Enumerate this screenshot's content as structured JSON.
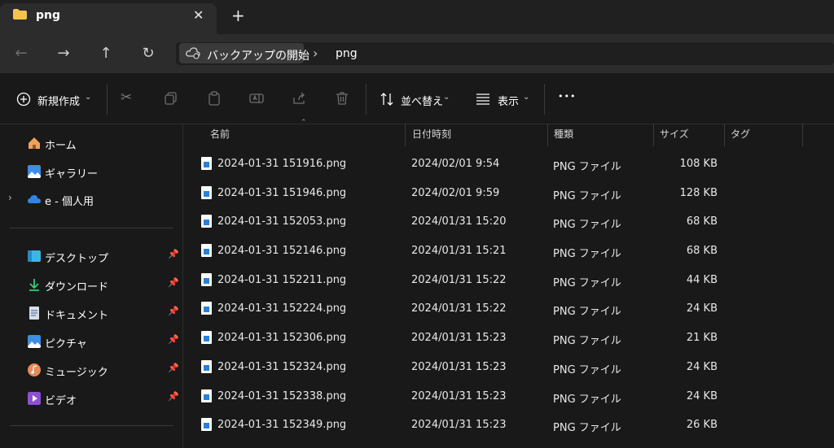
{
  "window": {
    "tab_title": "png",
    "close_glyph": "✕",
    "newtab_glyph": "+"
  },
  "nav": {
    "back_glyph": "←",
    "forward_glyph": "→",
    "up_glyph": "↑",
    "refresh_glyph": "↻",
    "breadcrumb": [
      "バックアップの開始",
      "png"
    ],
    "separator": "›"
  },
  "toolbar": {
    "new_label": "新規作成",
    "sort_label": "並べ替え",
    "view_label": "表示",
    "more_glyph": "•••"
  },
  "sidebar": {
    "top_items": [
      {
        "label": "ホーム",
        "icon": "home-icon"
      },
      {
        "label": "ギャラリー",
        "icon": "gallery-icon"
      },
      {
        "label": "e - 個人用",
        "icon": "cloud-icon"
      }
    ],
    "pinned_items": [
      {
        "label": "デスクトップ",
        "icon": "desktop-icon"
      },
      {
        "label": "ダウンロード",
        "icon": "download-icon"
      },
      {
        "label": "ドキュメント",
        "icon": "document-icon"
      },
      {
        "label": "ピクチャ",
        "icon": "pictures-icon"
      },
      {
        "label": "ミュージック",
        "icon": "music-icon"
      },
      {
        "label": "ビデオ",
        "icon": "video-icon"
      }
    ]
  },
  "columns": {
    "name": "名前",
    "date": "日付時刻",
    "type": "種類",
    "size": "サイズ",
    "tag": "タグ"
  },
  "files": [
    {
      "name": "2024-01-31 151916.png",
      "date": "2024/02/01 9:54",
      "type": "PNG ファイル",
      "size": "108 KB"
    },
    {
      "name": "2024-01-31 151946.png",
      "date": "2024/02/01 9:59",
      "type": "PNG ファイル",
      "size": "128 KB"
    },
    {
      "name": "2024-01-31 152053.png",
      "date": "2024/01/31 15:20",
      "type": "PNG ファイル",
      "size": "68 KB"
    },
    {
      "name": "2024-01-31 152146.png",
      "date": "2024/01/31 15:21",
      "type": "PNG ファイル",
      "size": "68 KB"
    },
    {
      "name": "2024-01-31 152211.png",
      "date": "2024/01/31 15:22",
      "type": "PNG ファイル",
      "size": "44 KB"
    },
    {
      "name": "2024-01-31 152224.png",
      "date": "2024/01/31 15:22",
      "type": "PNG ファイル",
      "size": "24 KB"
    },
    {
      "name": "2024-01-31 152306.png",
      "date": "2024/01/31 15:23",
      "type": "PNG ファイル",
      "size": "21 KB"
    },
    {
      "name": "2024-01-31 152324.png",
      "date": "2024/01/31 15:23",
      "type": "PNG ファイル",
      "size": "24 KB"
    },
    {
      "name": "2024-01-31 152338.png",
      "date": "2024/01/31 15:23",
      "type": "PNG ファイル",
      "size": "24 KB"
    },
    {
      "name": "2024-01-31 152349.png",
      "date": "2024/01/31 15:23",
      "type": "PNG ファイル",
      "size": "26 KB"
    }
  ],
  "colors": {
    "background": "#191919",
    "accent": "#2a7fd8",
    "folder": "#f4c34e"
  }
}
